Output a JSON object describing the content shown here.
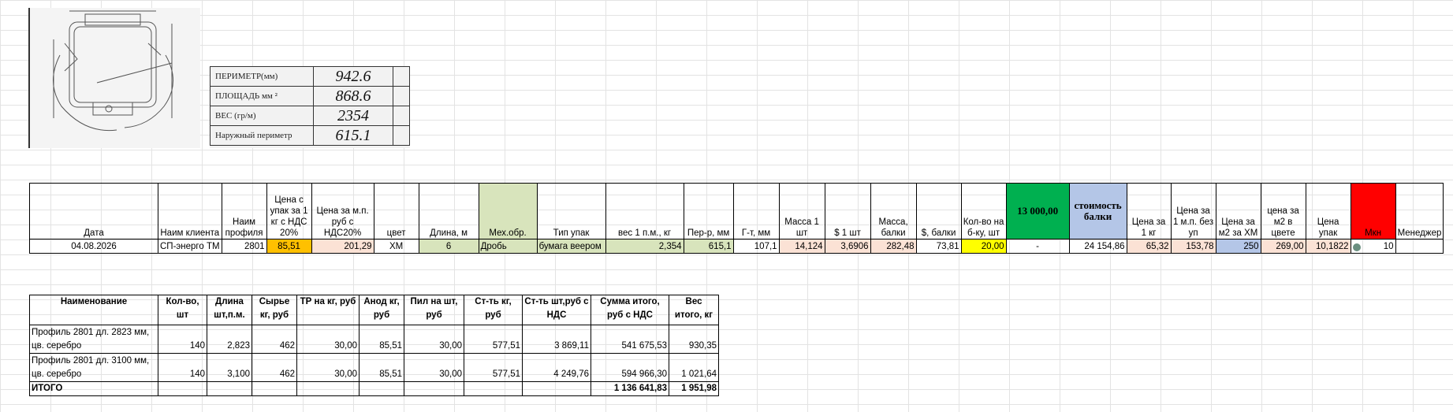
{
  "colors": {
    "orange": "#ffc000",
    "peach": "#fbe2d5",
    "green_light": "#d8e4bc",
    "yellow": "#ffff00",
    "green": "#00b050",
    "blue_light": "#b4c6e7",
    "red": "#ff0000",
    "grid": "#e3e3e3"
  },
  "props_image": {
    "rows": [
      {
        "label": "ПЕРИМЕТР(мм)",
        "value": "942.6"
      },
      {
        "label": "ПЛОЩАДЬ мм ²",
        "value": "868.6"
      },
      {
        "label": "ВЕС (гр/м)",
        "value": "2354"
      },
      {
        "label": "Наружный периметр",
        "value": "615.1"
      }
    ]
  },
  "main_table": {
    "headers": [
      "Дата",
      "Наим клиента",
      "Наим профиля",
      "Цена с упак за 1 кг с НДС 20%",
      "Цена за м.п. руб с НДС20%",
      "цвет",
      "Длина, м",
      "Мех.обр.",
      "Тип упак",
      "вес 1 п.м., кг",
      "Пер-р, мм",
      "Г-т, мм",
      "Масса 1 шт",
      "$ 1 шт",
      "Масса, балки",
      "$, балки",
      "Кол-во на б-ку, шт",
      "13 000,00",
      "стоимость балки",
      "Цена за 1 кг",
      "Цена за 1 м.п. без уп",
      "Цена за м2 за ХМ",
      "цена за м2 в цвете",
      "Цена упак",
      "Мкн",
      "Менеджер"
    ],
    "row": [
      "04.08.2026",
      "СП-энерго ТМ",
      "2801",
      "85,51",
      "201,29",
      "ХМ",
      "6",
      "Дробь",
      "бумага веером",
      "2,354",
      "615,1",
      "107,1",
      "14,124",
      "3,6906",
      "282,48",
      "73,81",
      "20,00",
      "-",
      "24 154,86",
      "65,32",
      "153,78",
      "250",
      "269,00",
      "10,1822",
      "10",
      ""
    ]
  },
  "summary_table": {
    "headers": [
      "Наименование",
      "Кол-во, шт",
      "Длина шт,п.м.",
      "Сырье кг, руб",
      "ТР на кг, руб",
      "Анод кг, руб",
      "Пил на шт, руб",
      "Ст-ть кг, руб",
      "Ст-ть шт,руб с НДС",
      "Сумма итого, руб с НДС",
      "Вес итого, кг"
    ],
    "rows": [
      [
        "Профиль 2801 дл. 2823 мм, цв. серебро",
        "140",
        "2,823",
        "462",
        "30,00",
        "85,51",
        "30,00",
        "577,51",
        "3 869,11",
        "541 675,53",
        "930,35"
      ],
      [
        "Профиль 2801 дл. 3100 мм, цв. серебро",
        "140",
        "3,100",
        "462",
        "30,00",
        "85,51",
        "30,00",
        "577,51",
        "4 249,76",
        "594 966,30",
        "1 021,64"
      ]
    ],
    "total": [
      "ИТОГО",
      "",
      "",
      "",
      "",
      "",
      "",
      "",
      "",
      "1 136 641,83",
      "1 951,98"
    ]
  }
}
